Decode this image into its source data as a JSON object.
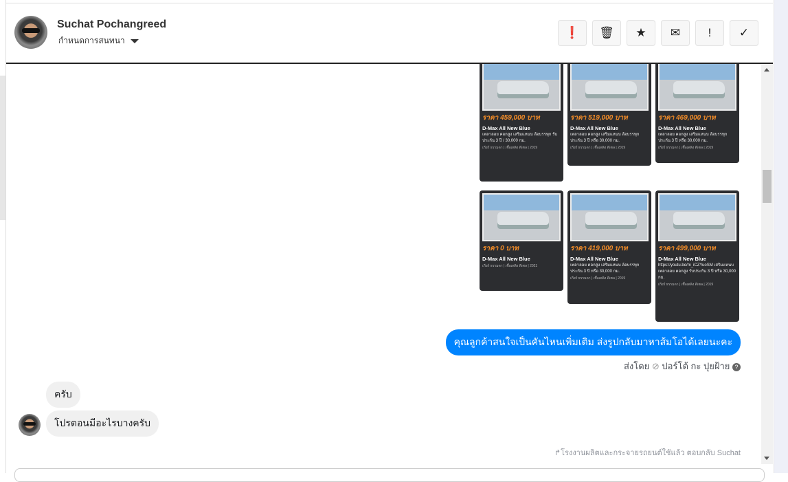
{
  "header": {
    "contact_name": "Suchat Pochangreed",
    "conversation_settings": "กำหนดการสนทนา",
    "actions": [
      {
        "name": "report-button",
        "icon": "alert-circle-icon",
        "glyph": "❗"
      },
      {
        "name": "delete-button",
        "icon": "trash-icon",
        "glyph": "🗑"
      },
      {
        "name": "star-button",
        "icon": "star-icon",
        "glyph": "★"
      },
      {
        "name": "mark-unread-button",
        "icon": "envelope-icon",
        "glyph": "✉"
      },
      {
        "name": "important-button",
        "icon": "exclamation-icon",
        "glyph": "!"
      },
      {
        "name": "done-button",
        "icon": "check-icon",
        "glyph": "✓"
      }
    ]
  },
  "cards": [
    {
      "price": "ราคา 459,000 บาท",
      "title": "D-Max All New Blue",
      "desc": "เพลาลอย คอกสูง เสริมแหนบ ล้อบรรทุก รับประกัน 3 ปี / 30,000 กม.",
      "foot": "เกียร์ ธรรมดา | เชื้อเพลิง ดีเซล | 2019"
    },
    {
      "price": "ราคา 519,000 บาท",
      "title": "D-Max All New Blue",
      "desc": "เพลาลอย คอกสูง เสริมแหนบ ล้อบรรทุก ประกัน 3 ปี หรือ 30,000 กม.",
      "foot": "เกียร์ ธรรมดา | เชื้อเพลิง ดีเซล | 2019"
    },
    {
      "price": "ราคา 469,000 บาท",
      "title": "D-Max All New Blue",
      "desc": "เพลาลอย คอกสูง เสริมแหนบ ล้อบรรทุก ประกัน 3 ปี หรือ 30,000 กม.",
      "foot": "เกียร์ ธรรมดา | เชื้อเพลิง ดีเซล | 2019"
    },
    {
      "price": "ราคา 0 บาท",
      "title": "D-Max All New Blue",
      "desc": "",
      "foot": "เกียร์ ธรรมดา | เชื้อเพลิง ดีเซล | 2021"
    },
    {
      "price": "ราคา 419,000 บาท",
      "title": "D-Max All New Blue",
      "desc": "เพลาลอย คอกสูง เสริมแหนบ ล้อบรรทุก ประกัน 3 ปี หรือ 30,000 กม.",
      "foot": "เกียร์ ธรรมดา | เชื้อเพลิง ดีเซล | 2019"
    },
    {
      "price": "ราคา 499,000 บาท",
      "title": "D-Max All New Blue",
      "desc": "https://youtu.be/m_iCZYuoSM เสริมแหนบ เพลาลอย คอกสูง รับประกัน 3 ปี หรือ 30,000 กม.",
      "foot": "เกียร์ ธรรมดา | เชื้อเพลิง ดีเซล | 2019"
    }
  ],
  "messages": {
    "outgoing": "คุณลูกค้าสนใจเป็นคันไหนเพิ่มเติม ส่งรูปกลับมาหาส้มโอได้เลยนะคะ",
    "sent_by_label": "ส่งโดย",
    "sent_by_name": "ปอร์โต้ กะ ปุยฝ้าย",
    "incoming_1": "ครับ",
    "incoming_2": "โปรตอนมีอะไรบางครับ",
    "reply_note": "โรงงานผลิตและกระจายรถยนต์ใช้แล้ว ตอบกลับ Suchat"
  }
}
